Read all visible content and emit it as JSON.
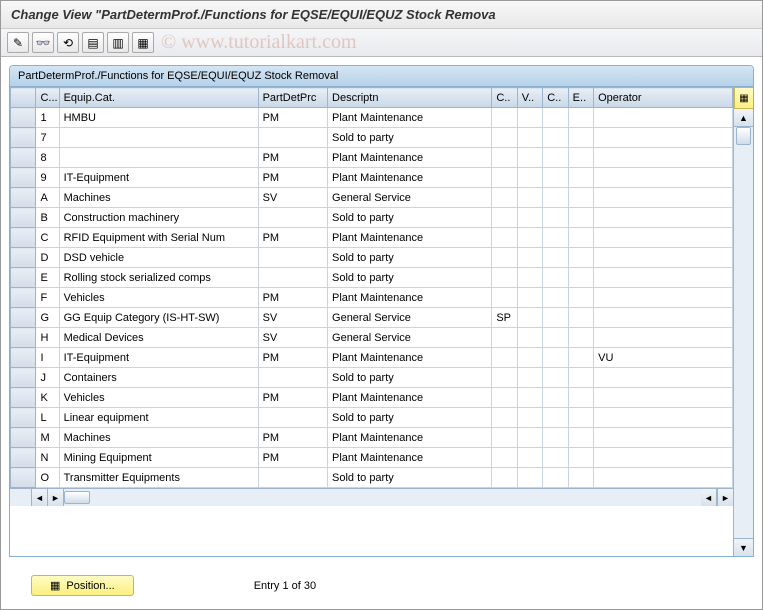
{
  "window_title": "Change View \"PartDetermProf./Functions for EQSE/EQUI/EQUZ Stock Remova",
  "watermark": "© www.tutorialkart.com",
  "panel_title": "PartDetermProf./Functions for EQSE/EQUI/EQUZ Stock Removal",
  "columns": {
    "c0": "C...",
    "equip_cat": "Equip.Cat.",
    "partdetprc": "PartDetPrc",
    "descriptn": "Descriptn",
    "c1": "C..",
    "v": "V..",
    "c2": "C..",
    "e": "E..",
    "operator": "Operator"
  },
  "rows": [
    {
      "c": "1",
      "equip": "HMBU",
      "pd": "PM",
      "desc": "Plant Maintenance",
      "c1": "",
      "v": "",
      "c2": "",
      "e": "",
      "op": ""
    },
    {
      "c": "7",
      "equip": "",
      "pd": "",
      "desc": "Sold to party",
      "c1": "",
      "v": "",
      "c2": "",
      "e": "",
      "op": ""
    },
    {
      "c": "8",
      "equip": "",
      "pd": "PM",
      "desc": "Plant Maintenance",
      "c1": "",
      "v": "",
      "c2": "",
      "e": "",
      "op": ""
    },
    {
      "c": "9",
      "equip": "IT-Equipment",
      "pd": "PM",
      "desc": "Plant Maintenance",
      "c1": "",
      "v": "",
      "c2": "",
      "e": "",
      "op": ""
    },
    {
      "c": "A",
      "equip": "Machines",
      "pd": "SV",
      "desc": "General Service",
      "c1": "",
      "v": "",
      "c2": "",
      "e": "",
      "op": ""
    },
    {
      "c": "B",
      "equip": "Construction machinery",
      "pd": "",
      "desc": "Sold to party",
      "c1": "",
      "v": "",
      "c2": "",
      "e": "",
      "op": ""
    },
    {
      "c": "C",
      "equip": "RFID Equipment with Serial Num",
      "pd": "PM",
      "desc": "Plant Maintenance",
      "c1": "",
      "v": "",
      "c2": "",
      "e": "",
      "op": ""
    },
    {
      "c": "D",
      "equip": "DSD vehicle",
      "pd": "",
      "desc": "Sold to party",
      "c1": "",
      "v": "",
      "c2": "",
      "e": "",
      "op": ""
    },
    {
      "c": "E",
      "equip": "Rolling stock serialized comps",
      "pd": "",
      "desc": "Sold to party",
      "c1": "",
      "v": "",
      "c2": "",
      "e": "",
      "op": ""
    },
    {
      "c": "F",
      "equip": "Vehicles",
      "pd": "PM",
      "desc": "Plant Maintenance",
      "c1": "",
      "v": "",
      "c2": "",
      "e": "",
      "op": ""
    },
    {
      "c": "G",
      "equip": "GG Equip Category (IS-HT-SW)",
      "pd": "SV",
      "desc": "General Service",
      "c1": "SP",
      "v": "",
      "c2": "",
      "e": "",
      "op": ""
    },
    {
      "c": "H",
      "equip": "Medical Devices",
      "pd": "SV",
      "desc": "General Service",
      "c1": "",
      "v": "",
      "c2": "",
      "e": "",
      "op": ""
    },
    {
      "c": "I",
      "equip": "IT-Equipment",
      "pd": "PM",
      "desc": "Plant Maintenance",
      "c1": "",
      "v": "",
      "c2": "",
      "e": "",
      "op": "VU"
    },
    {
      "c": "J",
      "equip": "Containers",
      "pd": "",
      "desc": "Sold to party",
      "c1": "",
      "v": "",
      "c2": "",
      "e": "",
      "op": ""
    },
    {
      "c": "K",
      "equip": "Vehicles",
      "pd": "PM",
      "desc": "Plant Maintenance",
      "c1": "",
      "v": "",
      "c2": "",
      "e": "",
      "op": ""
    },
    {
      "c": "L",
      "equip": "Linear equipment",
      "pd": "",
      "desc": "Sold to party",
      "c1": "",
      "v": "",
      "c2": "",
      "e": "",
      "op": ""
    },
    {
      "c": "M",
      "equip": "Machines",
      "pd": "PM",
      "desc": "Plant Maintenance",
      "c1": "",
      "v": "",
      "c2": "",
      "e": "",
      "op": ""
    },
    {
      "c": "N",
      "equip": "Mining Equipment",
      "pd": "PM",
      "desc": "Plant Maintenance",
      "c1": "",
      "v": "",
      "c2": "",
      "e": "",
      "op": ""
    },
    {
      "c": "O",
      "equip": "Transmitter Equipments",
      "pd": "",
      "desc": "Sold to party",
      "c1": "",
      "v": "",
      "c2": "",
      "e": "",
      "op": ""
    }
  ],
  "footer": {
    "position_btn": "Position...",
    "entry_text": "Entry 1 of 30"
  },
  "toolbar_icons": [
    "pencil-icon",
    "glasses-icon",
    "undo-icon",
    "save-icon",
    "save-new-icon",
    "list-icon"
  ]
}
